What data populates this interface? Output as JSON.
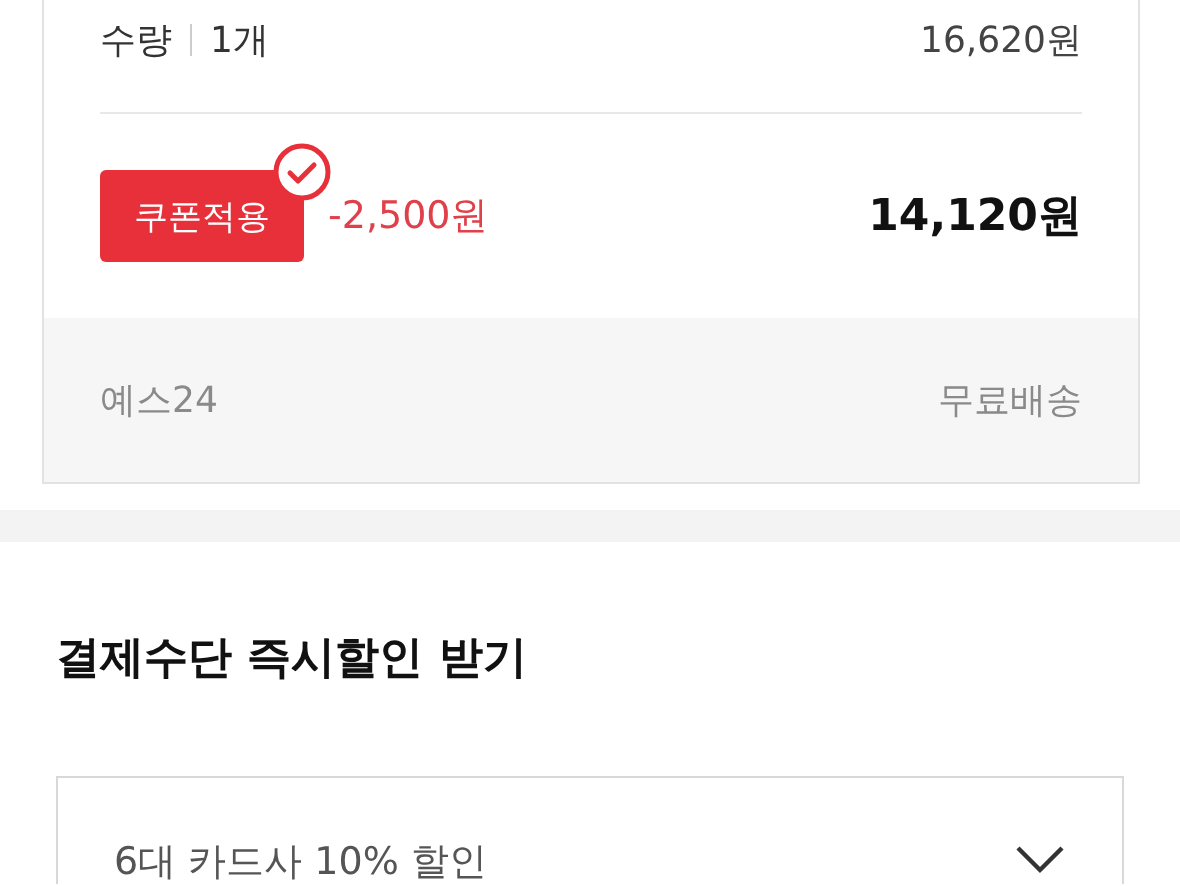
{
  "item": {
    "quantity_label": "수량",
    "quantity": "1개",
    "price": "16,620원"
  },
  "coupon": {
    "button": "쿠폰적용",
    "applied": true,
    "discount": "-2,500원",
    "total": "14,120원"
  },
  "shipping": {
    "seller": "예스24",
    "fee": "무료배송"
  },
  "payment": {
    "heading": "결제수단 즉시할인 받기",
    "dropdown": {
      "value": "6대 카드사 10% 할인",
      "expanded": false
    }
  }
}
